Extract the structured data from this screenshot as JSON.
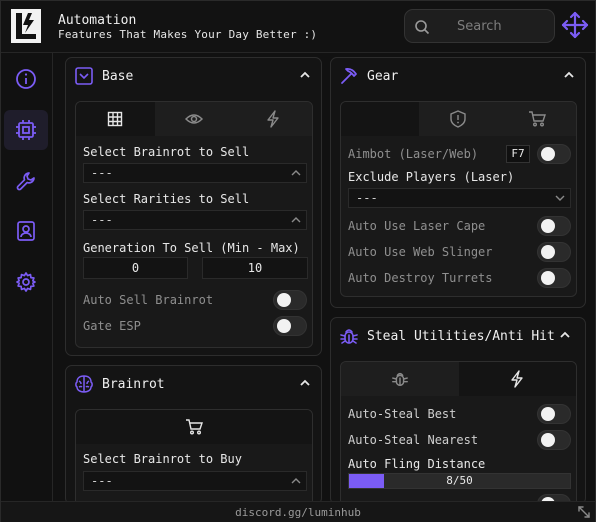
{
  "header": {
    "title": "Automation",
    "subtitle": "Features That Makes Your Day Better :)",
    "search_placeholder": "Search"
  },
  "colors": {
    "accent": "#7b5cf5",
    "bg": "#111111",
    "panel": "#141414"
  },
  "sidebar": {
    "items": [
      {
        "icon": "info-icon",
        "active": false
      },
      {
        "icon": "chip-icon",
        "active": true
      },
      {
        "icon": "wrench-icon",
        "active": false
      },
      {
        "icon": "contact-icon",
        "active": false
      },
      {
        "icon": "gear-icon",
        "active": false
      }
    ]
  },
  "base": {
    "title": "Base",
    "tabs": [
      "grid-icon",
      "eye-icon",
      "bolt-icon"
    ],
    "select_sell_label": "Select Brainrot to Sell",
    "select_sell_value": "---",
    "rarities_label": "Select Rarities to Sell",
    "rarities_value": "---",
    "generation_label": "Generation To Sell (Min - Max)",
    "gen_min": "0",
    "gen_max": "10",
    "auto_sell_label": "Auto Sell Brainrot",
    "gate_esp_label": "Gate ESP"
  },
  "brainrot": {
    "title": "Brainrot",
    "buy_label": "Select Brainrot to Buy",
    "buy_value": "---"
  },
  "gear": {
    "title": "Gear",
    "aimbot_label": "Aimbot (Laser/Web)",
    "aimbot_key": "F7",
    "exclude_label": "Exclude Players (Laser)",
    "exclude_value": "---",
    "laser_cape_label": "Auto Use Laser Cape",
    "web_slinger_label": "Auto Use Web Slinger",
    "destroy_turrets_label": "Auto Destroy Turrets"
  },
  "steal": {
    "title": "Steal Utilities/Anti Hit",
    "steal_best_label": "Auto-Steal Best",
    "steal_nearest_label": "Auto-Steal Nearest",
    "fling_label": "Auto Fling Distance",
    "fling_value": "8/50",
    "fling_fraction": 0.16
  },
  "footer": {
    "text": "discord.gg/luminhub"
  }
}
